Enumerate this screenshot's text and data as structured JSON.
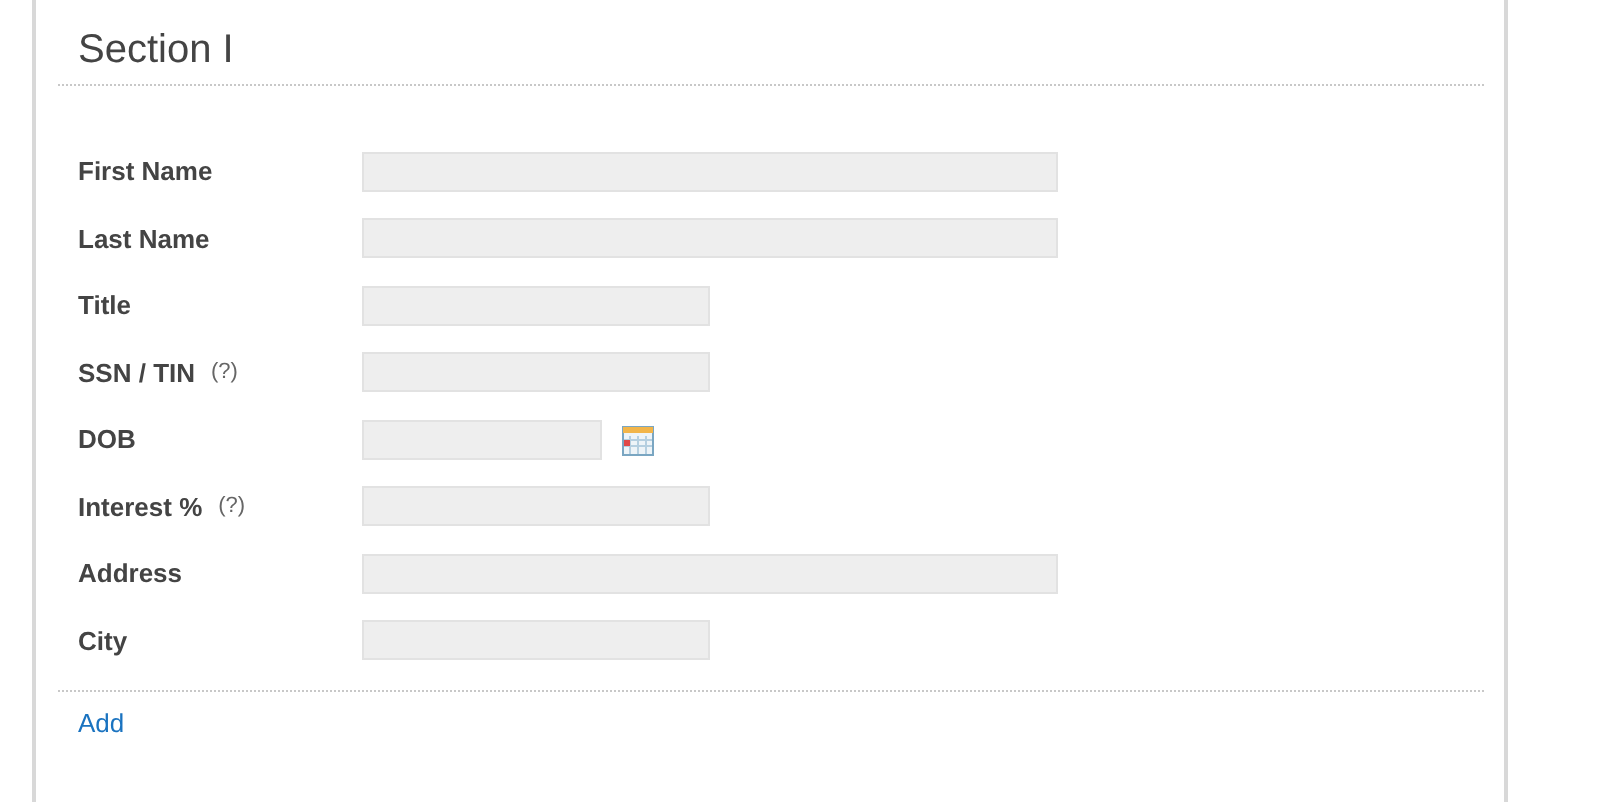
{
  "section": {
    "title": "Section I"
  },
  "fields": [
    {
      "label": "First Name",
      "kind": "long"
    },
    {
      "label": "Last Name",
      "kind": "long"
    },
    {
      "label": "Title",
      "kind": "short"
    },
    {
      "label": "SSN / TIN",
      "help": "(?)",
      "kind": "short"
    },
    {
      "label": "DOB",
      "kind": "date"
    },
    {
      "label": "Interest %",
      "help": "(?)",
      "kind": "short"
    },
    {
      "label": "Address",
      "kind": "long"
    },
    {
      "label": "City",
      "kind": "short"
    }
  ],
  "add_link": "Add"
}
